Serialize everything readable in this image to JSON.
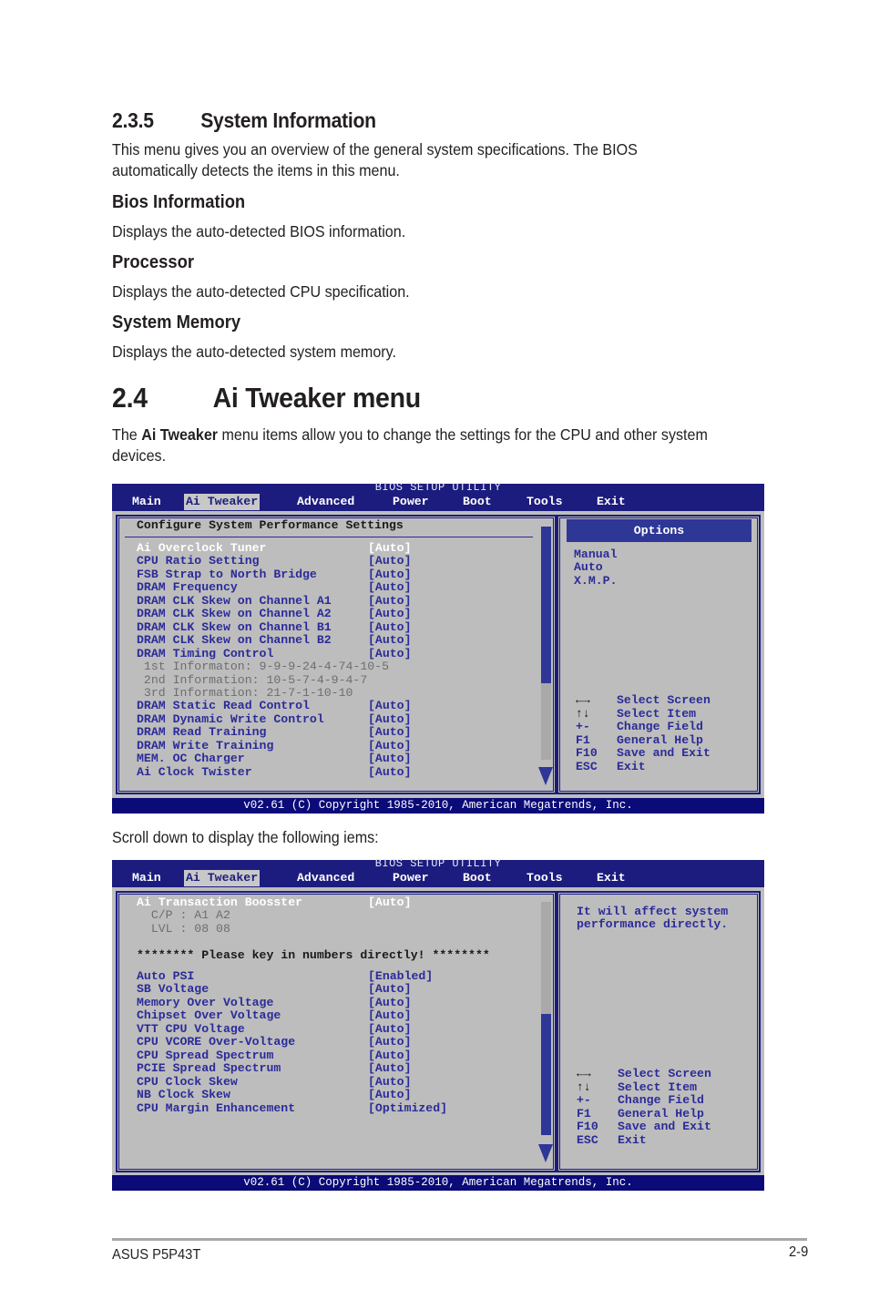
{
  "section_235": {
    "number": "2.3.5",
    "title": "System Information",
    "intro_line1": "This menu gives you an overview of the general system specifications. The BIOS",
    "intro_line2": "automatically detects the items in this menu.",
    "subsections": [
      {
        "title": "Bios Information",
        "text": "Displays the auto-detected BIOS information."
      },
      {
        "title": "Processor",
        "text": "Displays the auto-detected CPU specification."
      },
      {
        "title": "System Memory",
        "text": "Displays the auto-detected system memory."
      }
    ]
  },
  "section_24": {
    "number": "2.4",
    "title": "Ai Tweaker menu",
    "intro_prefix": "The ",
    "intro_bold": "Ai Tweaker",
    "intro_rest": " menu items allow you to change the settings for the CPU and other system",
    "intro_line2": "devices.",
    "scroll_note": "Scroll down to display the following iems:"
  },
  "bios": {
    "title": "BIOS SETUP UTILITY",
    "tabs": [
      "Main",
      "Ai Tweaker",
      "Advanced",
      "Power",
      "Boot",
      "Tools",
      "Exit"
    ],
    "active_tab": "Ai Tweaker",
    "copyright": "v02.61 (C) Copyright 1985-2010, American Megatrends, Inc.",
    "help_keys": [
      {
        "key": "←→",
        "desc": "Select Screen"
      },
      {
        "key": "↑↓",
        "desc": "Select Item"
      },
      {
        "key": "+-",
        "desc": "Change Field"
      },
      {
        "key": "F1",
        "desc": "General Help"
      },
      {
        "key": "F10",
        "desc": "Save and Exit"
      },
      {
        "key": "ESC",
        "desc": "Exit"
      }
    ]
  },
  "screen1": {
    "header": "Configure System Performance Settings",
    "items": [
      {
        "label": "Ai Overclock Tuner",
        "value": "[Auto]",
        "selected": true
      },
      {
        "label": "CPU Ratio Setting",
        "value": "[Auto]"
      },
      {
        "label": "FSB Strap to North Bridge",
        "value": "[Auto]"
      },
      {
        "label": "DRAM Frequency",
        "value": "[Auto]"
      },
      {
        "label": "DRAM CLK Skew on Channel A1",
        "value": "[Auto]"
      },
      {
        "label": "DRAM CLK Skew on Channel A2",
        "value": "[Auto]"
      },
      {
        "label": "DRAM CLK Skew on Channel B1",
        "value": "[Auto]"
      },
      {
        "label": "DRAM CLK Skew on Channel B2",
        "value": "[Auto]"
      },
      {
        "label": "DRAM Timing Control",
        "value": "[Auto]"
      }
    ],
    "info": [
      " 1st Informaton: 9-9-9-24-4-74-10-5",
      " 2nd Information: 10-5-7-4-9-4-7",
      " 3rd Information: 21-7-1-10-10"
    ],
    "items2": [
      {
        "label": "DRAM Static Read Control",
        "value": "[Auto]"
      },
      {
        "label": "DRAM Dynamic Write Control",
        "value": "[Auto]"
      },
      {
        "label": "DRAM Read Training",
        "value": "[Auto]"
      },
      {
        "label": "DRAM Write Training",
        "value": "[Auto]"
      },
      {
        "label": "MEM. OC Charger",
        "value": "[Auto]"
      },
      {
        "label": "Ai Clock Twister",
        "value": "[Auto]"
      }
    ],
    "options_title": "Options",
    "options": [
      "Manual",
      "Auto",
      "X.M.P."
    ],
    "scroll_position": "top"
  },
  "screen2": {
    "items": [
      {
        "label": "Ai Transaction Boosster",
        "value": "[Auto]",
        "selected": true
      }
    ],
    "info": [
      "  C/P : A1 A2",
      "  LVL : 08 08"
    ],
    "notice": "******** Please key in numbers directly! ********",
    "items2": [
      {
        "label": "Auto PSI",
        "value": "[Enabled]"
      },
      {
        "label": "SB Voltage",
        "value": "[Auto]"
      },
      {
        "label": "Memory Over Voltage",
        "value": "[Auto]"
      },
      {
        "label": "Chipset Over Voltage",
        "value": "[Auto]"
      },
      {
        "label": "VTT CPU Voltage",
        "value": "[Auto]"
      },
      {
        "label": "CPU VCORE Over-Voltage",
        "value": "[Auto]"
      },
      {
        "label": "CPU Spread Spectrum",
        "value": "[Auto]"
      },
      {
        "label": "PCIE Spread Spectrum",
        "value": "[Auto]"
      },
      {
        "label": "CPU Clock Skew",
        "value": "[Auto]"
      },
      {
        "label": "NB Clock Skew",
        "value": "[Auto]"
      },
      {
        "label": "CPU Margin Enhancement",
        "value": "[Optimized]"
      }
    ],
    "help_text": [
      "It will affect system",
      "performance directly."
    ],
    "scroll_position": "bottom"
  },
  "footer": {
    "product": "ASUS P5P43T",
    "page": "2-9"
  }
}
